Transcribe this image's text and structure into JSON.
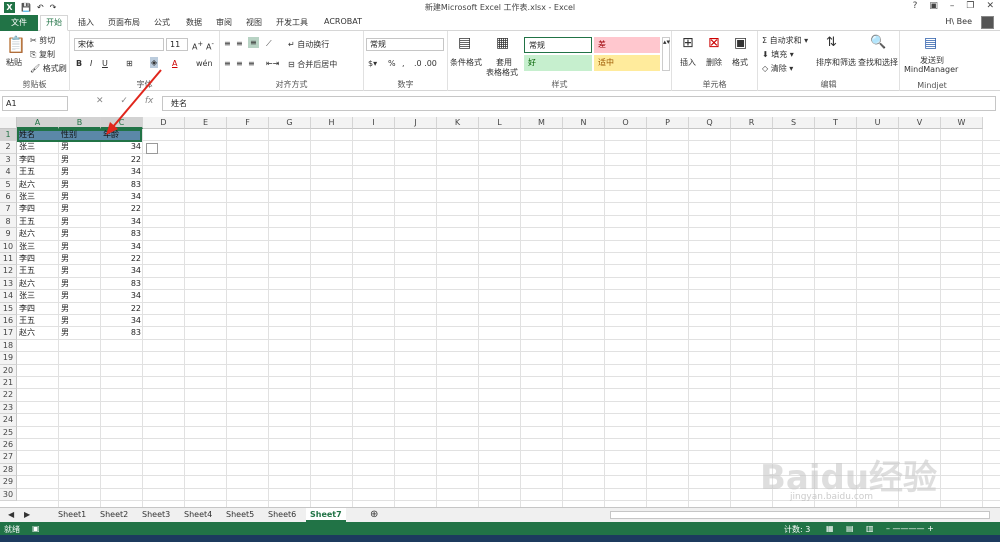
{
  "window": {
    "title": "新建Microsoft Excel 工作表.xlsx - Excel",
    "user": "H\\ Bee"
  },
  "menu": {
    "file": "文件",
    "tabs": [
      "开始",
      "插入",
      "页面布局",
      "公式",
      "数据",
      "审阅",
      "视图",
      "开发工具",
      "ACROBAT"
    ]
  },
  "ribbon": {
    "clipboard": {
      "label": "剪贴板",
      "paste": "粘贴",
      "cut": "剪切",
      "copy": "复制",
      "painter": "格式刷"
    },
    "font": {
      "label": "字体",
      "name": "宋体",
      "size": "11"
    },
    "align": {
      "label": "对齐方式",
      "wrap": "自动换行",
      "merge": "合并后居中"
    },
    "number": {
      "label": "数字",
      "format": "常规"
    },
    "styles": {
      "label": "样式",
      "cond": "条件格式",
      "table": "套用",
      "table2": "表格格式",
      "normal": "常规",
      "bad": "差",
      "good": "好",
      "neutral": "适中"
    },
    "cells": {
      "label": "单元格",
      "insert": "插入",
      "delete": "删除",
      "format": "格式"
    },
    "edit": {
      "label": "编辑",
      "autosum": "自动求和",
      "fill": "填充",
      "clear": "清除",
      "sort": "排序和筛选",
      "find": "查找和选择"
    },
    "mindjet": {
      "label": "Mindjet",
      "send": "发送到",
      "mm": "MindManager"
    }
  },
  "formula_bar": {
    "namebox": "A1",
    "fx": "fx",
    "value": "姓名"
  },
  "columns": [
    "A",
    "B",
    "C",
    "D",
    "E",
    "F",
    "G",
    "H",
    "I",
    "J",
    "K",
    "L",
    "M",
    "N",
    "O",
    "P",
    "Q",
    "R",
    "S",
    "T",
    "U",
    "V",
    "W"
  ],
  "rows": [
    "1",
    "2",
    "3",
    "4",
    "5",
    "6",
    "7",
    "8",
    "9",
    "10",
    "11",
    "12",
    "13",
    "14",
    "15",
    "16",
    "17",
    "18",
    "19",
    "20",
    "21",
    "22",
    "23",
    "24",
    "25",
    "26",
    "27",
    "28",
    "29",
    "30"
  ],
  "header": [
    "姓名",
    "性别",
    "年龄"
  ],
  "data": [
    [
      "张三",
      "男",
      "34"
    ],
    [
      "李四",
      "男",
      "22"
    ],
    [
      "王五",
      "男",
      "34"
    ],
    [
      "赵六",
      "男",
      "83"
    ],
    [
      "张三",
      "男",
      "34"
    ],
    [
      "李四",
      "男",
      "22"
    ],
    [
      "王五",
      "男",
      "34"
    ],
    [
      "赵六",
      "男",
      "83"
    ],
    [
      "张三",
      "男",
      "34"
    ],
    [
      "李四",
      "男",
      "22"
    ],
    [
      "王五",
      "男",
      "34"
    ],
    [
      "赵六",
      "男",
      "83"
    ],
    [
      "张三",
      "男",
      "34"
    ],
    [
      "李四",
      "男",
      "22"
    ],
    [
      "王五",
      "男",
      "34"
    ],
    [
      "赵六",
      "男",
      "83"
    ]
  ],
  "sheets": [
    "Sheet1",
    "Sheet2",
    "Sheet3",
    "Sheet4",
    "Sheet5",
    "Sheet6",
    "Sheet7"
  ],
  "active_sheet": "Sheet7",
  "status": {
    "ready": "就绪",
    "count": "计数: 3"
  },
  "watermark": {
    "logo": "Baidu经验",
    "url": "jingyan.baidu.com"
  }
}
